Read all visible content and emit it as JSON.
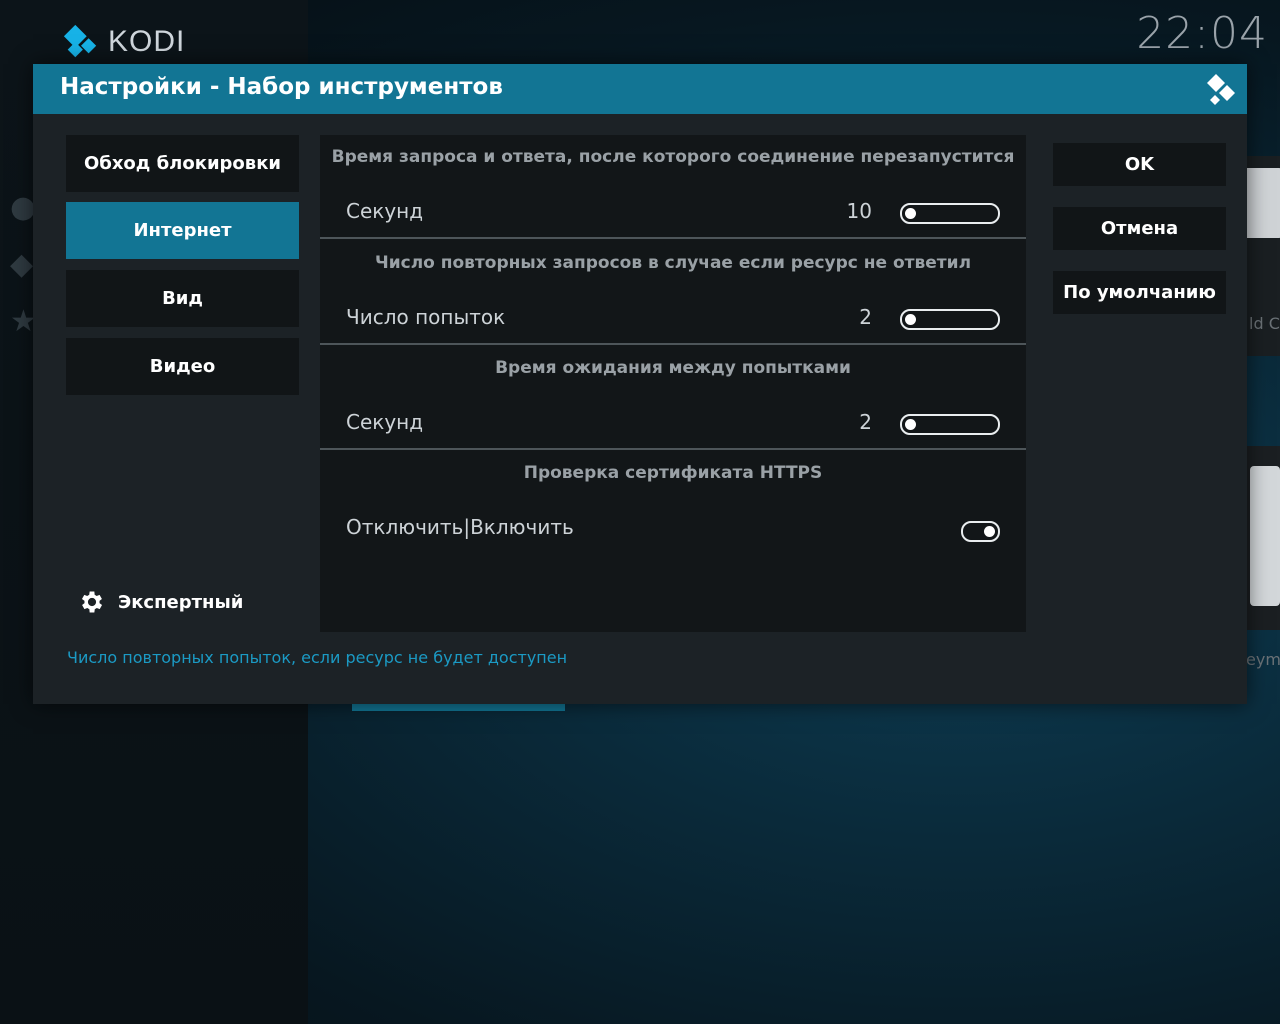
{
  "app": {
    "brand": "KODI",
    "clock": "22:04"
  },
  "background": {
    "tile1_text": "ld Ca",
    "tile2_text": "eyma"
  },
  "dialog": {
    "title": "Настройки - Набор инструментов",
    "categories": [
      {
        "label": "Обход блокировки",
        "active": false
      },
      {
        "label": "Интернет",
        "active": true
      },
      {
        "label": "Вид",
        "active": false
      },
      {
        "label": "Видео",
        "active": false
      }
    ],
    "level": {
      "label": "Экспертный",
      "icon": "gear-icon"
    },
    "settings": [
      {
        "title": "Время запроса и ответа, после которого соединение перезапустится",
        "label": "Секунд",
        "value": "10",
        "control": "slider"
      },
      {
        "title": "Число повторных запросов в случае если ресурс не ответил",
        "label": "Число попыток",
        "value": "2",
        "control": "slider"
      },
      {
        "title": "Время ожидания между попытками",
        "label": "Секунд",
        "value": "2",
        "control": "slider"
      },
      {
        "title": "Проверка сертификата HTTPS",
        "label": "Отключить|Включить",
        "value": "",
        "control": "toggle",
        "toggle_on": true
      }
    ],
    "buttons": {
      "ok": "OK",
      "cancel": "Отмена",
      "defaults": "По умолчанию"
    },
    "hint": "Число повторных попыток, если ресурс не будет доступен"
  },
  "colors": {
    "accent": "#127594",
    "hint": "#1b9ac4"
  }
}
